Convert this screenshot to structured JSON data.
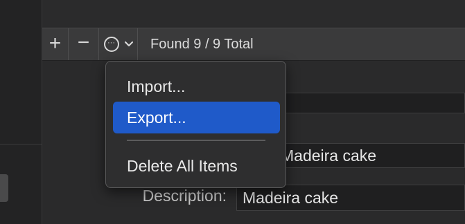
{
  "toolbar": {
    "add_icon": "plus-icon",
    "remove_icon": "minus-icon",
    "options_icon": "ellipsis-circle-icon",
    "dropdown_icon": "chevron-down-icon",
    "add_glyph": "+",
    "remove_glyph": "−",
    "options_glyph": "···",
    "chevron_glyph": "⌄",
    "status": "Found 9 / 9 Total"
  },
  "menu": {
    "items": [
      {
        "label": "Import..."
      },
      {
        "label": "Export..."
      },
      {
        "label": "Delete All Items"
      }
    ],
    "selected_index": 1,
    "accent_color": "#1f5ac9"
  },
  "form": {
    "name_value": "Madeira cake",
    "description_label": "Description:",
    "description_value": "Madeira cake"
  }
}
